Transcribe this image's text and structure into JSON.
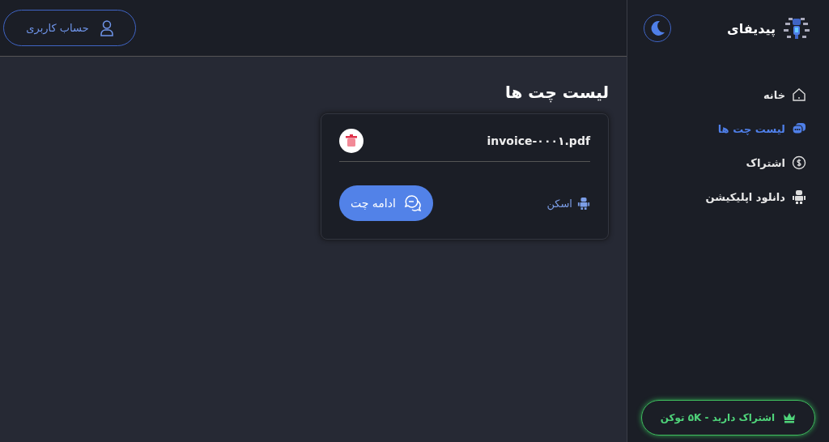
{
  "sidebar": {
    "brand": "پیدیفای",
    "dark_mode": true,
    "items": [
      {
        "label": "خانه",
        "kind": "home",
        "selected": false
      },
      {
        "label": "لیست چت ها",
        "kind": "chats",
        "selected": true
      },
      {
        "label": "اشتراک",
        "kind": "subscription",
        "selected": false
      },
      {
        "label": "دانلود اپلیکیشن",
        "kind": "download",
        "selected": false
      }
    ],
    "subscription_badge": "اشتراک دارید - ۵K توکن"
  },
  "header": {
    "account_button": "حساب کاربری"
  },
  "page_title": "لیست چت ها",
  "chats": [
    {
      "file_name": "invoice-۰۰۰۱.pdf",
      "status": "اسکن",
      "continue_button": "ادامه چت"
    }
  ]
}
